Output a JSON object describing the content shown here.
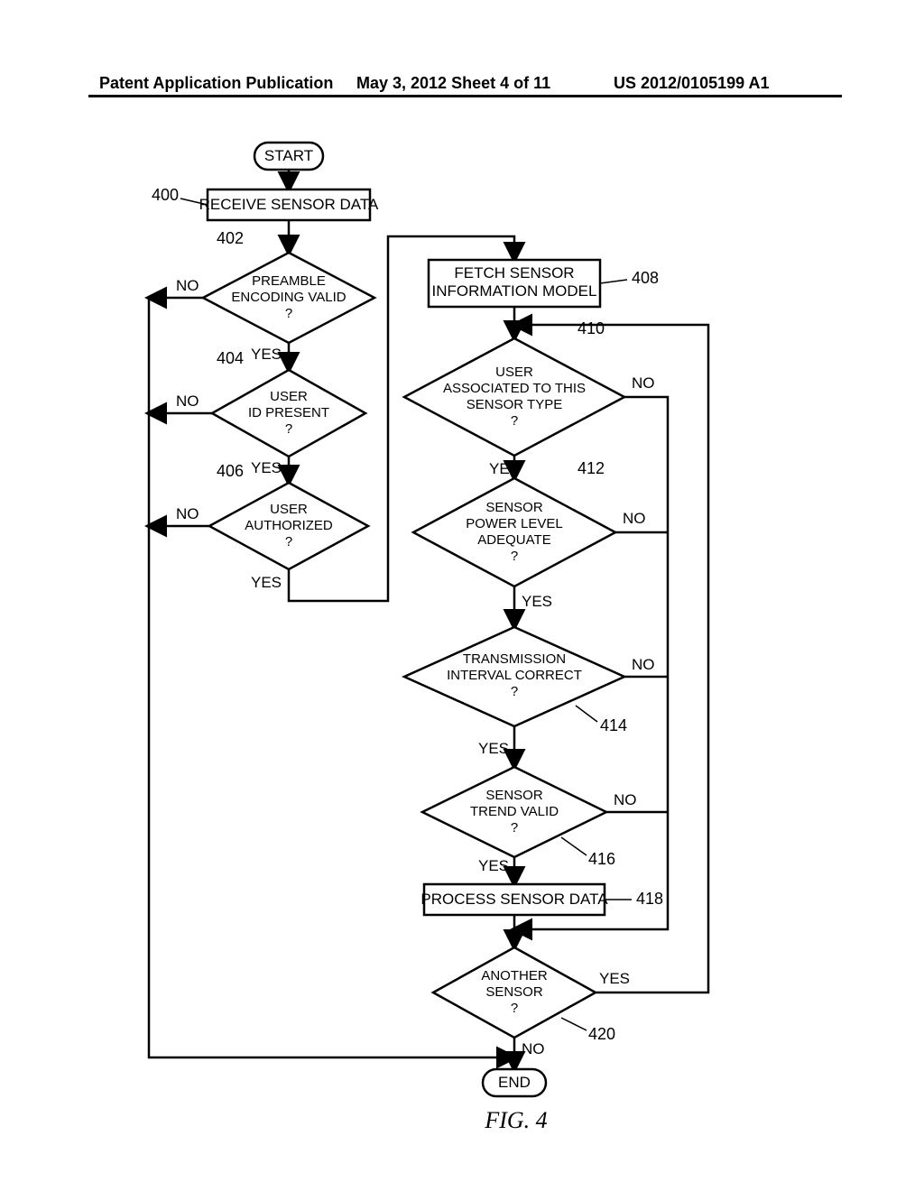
{
  "header": {
    "left": "Patent Application Publication",
    "mid": "May 3, 2012   Sheet 4 of 11",
    "right": "US 2012/0105199 A1"
  },
  "terminals": {
    "start": "START",
    "end": "END"
  },
  "boxes": {
    "b400": "RECEIVE SENSOR DATA",
    "b408_l1": "FETCH SENSOR",
    "b408_l2": "INFORMATION MODEL",
    "b418": "PROCESS SENSOR DATA"
  },
  "decisions": {
    "d402_l1": "PREAMBLE",
    "d402_l2": "ENCODING VALID",
    "d402_l3": "?",
    "d404_l1": "USER",
    "d404_l2": "ID PRESENT",
    "d404_l3": "?",
    "d406_l1": "USER",
    "d406_l2": "AUTHORIZED",
    "d406_l3": "?",
    "d410_l1": "USER",
    "d410_l2": "ASSOCIATED TO THIS",
    "d410_l3": "SENSOR TYPE",
    "d410_l4": "?",
    "d412_l1": "SENSOR",
    "d412_l2": "POWER LEVEL",
    "d412_l3": "ADEQUATE",
    "d412_l4": "?",
    "d414_l1": "TRANSMISSION",
    "d414_l2": "INTERVAL CORRECT",
    "d414_l3": "?",
    "d416_l1": "SENSOR",
    "d416_l2": "TREND VALID",
    "d416_l3": "?",
    "d420_l1": "ANOTHER",
    "d420_l2": "SENSOR",
    "d420_l3": "?"
  },
  "labels": {
    "yes": "YES",
    "no": "NO"
  },
  "refs": {
    "n400": "400",
    "n402": "402",
    "n404": "404",
    "n406": "406",
    "n408": "408",
    "n410": "410",
    "n412": "412",
    "n414": "414",
    "n416": "416",
    "n418": "418",
    "n420": "420"
  },
  "figure": "FIG. 4"
}
